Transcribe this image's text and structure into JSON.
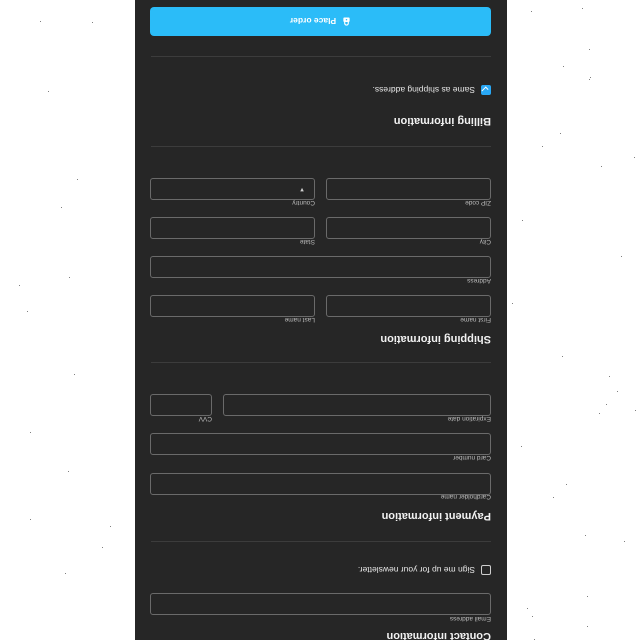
{
  "contact": {
    "title": "Contact information",
    "email_label": "Email address",
    "newsletter_label": "Sign me up for your newsletter.",
    "newsletter_checked": false
  },
  "payment": {
    "title": "Payment information",
    "cardholder_label": "Cardholder name",
    "card_number_label": "Card number",
    "expiration_label": "Expiration date",
    "cvv_label": "CVV"
  },
  "shipping": {
    "title": "Shipping information",
    "first_name_label": "First name",
    "last_name_label": "Last name",
    "address_label": "Address",
    "city_label": "City",
    "state_label": "State",
    "zip_label": "ZIP code",
    "country_label": "Country"
  },
  "billing": {
    "title": "Billing information",
    "same_as_shipping_label": "Same as shipping address.",
    "same_as_shipping_checked": true
  },
  "actions": {
    "place_order_label": "Place order",
    "lock_icon": "lock-icon"
  },
  "colors": {
    "panel_background": "#262626",
    "accent": "#2bbcf8"
  }
}
